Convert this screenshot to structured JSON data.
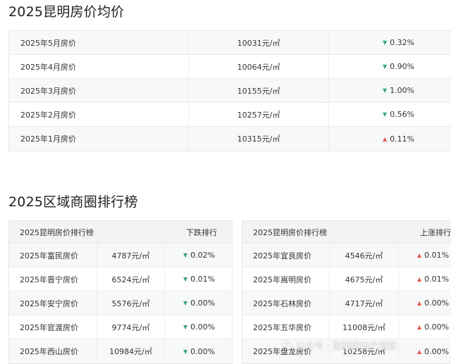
{
  "section1": {
    "title": "2025昆明房价均价",
    "rows": [
      {
        "month": "2025年5月房价",
        "price": "10031元/㎡",
        "trend": "down",
        "change": "0.32%"
      },
      {
        "month": "2025年4月房价",
        "price": "10064元/㎡",
        "trend": "down",
        "change": "0.90%"
      },
      {
        "month": "2025年3月房价",
        "price": "10155元/㎡",
        "trend": "down",
        "change": "1.00%"
      },
      {
        "month": "2025年2月房价",
        "price": "10257元/㎡",
        "trend": "down",
        "change": "0.56%"
      },
      {
        "month": "2025年1月房价",
        "price": "10315元/㎡",
        "trend": "up",
        "change": "0.11%"
      }
    ]
  },
  "section2": {
    "title": "2025区域商圈排行榜",
    "left_table": {
      "header_name": "2025昆明房价排行榜",
      "header_rank": "下跌排行",
      "rows": [
        {
          "district": "2025年富民房价",
          "price": "4787元/㎡",
          "trend": "down",
          "change": "0.02%"
        },
        {
          "district": "2025年晋宁房价",
          "price": "6524元/㎡",
          "trend": "down",
          "change": "0.01%"
        },
        {
          "district": "2025年安宁房价",
          "price": "5576元/㎡",
          "trend": "down",
          "change": "0.00%"
        },
        {
          "district": "2025年官渡房价",
          "price": "9774元/㎡",
          "trend": "down",
          "change": "0.00%"
        },
        {
          "district": "2025年西山房价",
          "price": "10984元/㎡",
          "trend": "down",
          "change": "0.00%"
        }
      ]
    },
    "right_table": {
      "header_name": "2025昆明房价排行榜",
      "header_rank": "上涨排行",
      "rows": [
        {
          "district": "2025年宜良房价",
          "price": "4546元/㎡",
          "trend": "up",
          "change": "0.01%"
        },
        {
          "district": "2025年嵩明房价",
          "price": "4675元/㎡",
          "trend": "up",
          "change": "0.01%"
        },
        {
          "district": "2025年石林房价",
          "price": "4717元/㎡",
          "trend": "up",
          "change": "0.00%"
        },
        {
          "district": "2025年五华房价",
          "price": "11008元/㎡",
          "trend": "up",
          "change": "0.00%"
        },
        {
          "district": "2025年盘龙房价",
          "price": "10258元/㎡",
          "trend": "up",
          "change": "0.00%"
        }
      ]
    }
  },
  "watermark": {
    "text": "公众号 · 昆明房地产观察",
    "icon": "wechat-icon"
  },
  "colors": {
    "down": "#3aa57a",
    "up": "#e05a4f"
  }
}
